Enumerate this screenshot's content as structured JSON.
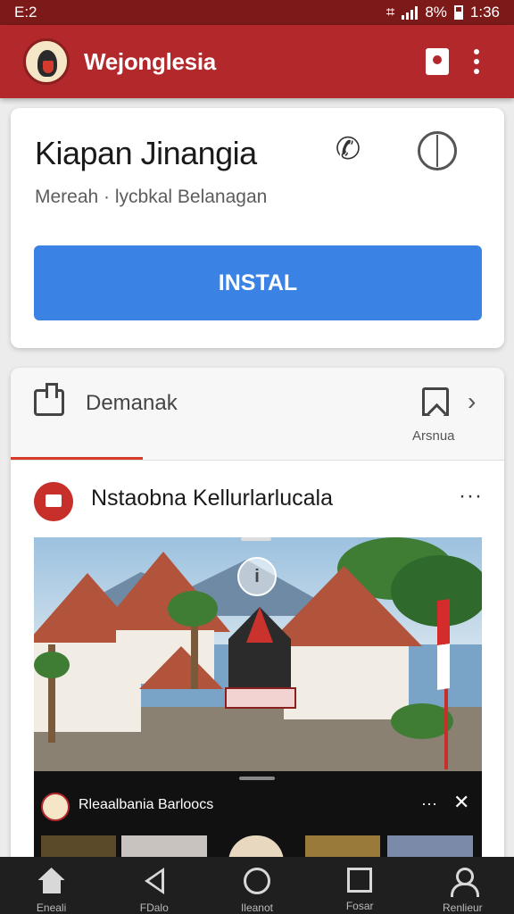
{
  "status_bar": {
    "time_left": "E:2",
    "battery_text": "8%",
    "time_right": "1:36"
  },
  "app_bar": {
    "title": "Wejonglesia",
    "icons": [
      "app-logo-icon",
      "bookmark-icon",
      "more-vert-icon"
    ],
    "accent_color": "#b3282a"
  },
  "listing": {
    "title": "Kiapan Jinangia",
    "subtitle": "Mereah · lycbkal Belanagan",
    "install_label": "INSTAL",
    "install_color": "#3b82e5",
    "icons": [
      "phone-icon",
      "globe-icon"
    ]
  },
  "tabs": {
    "left_label": "Demanak",
    "right_label": "Arsnua",
    "active_indicator_color": "#d63a2a"
  },
  "post": {
    "title": "Nstaobna Kellurlarlucala",
    "more_label": "···"
  },
  "video": {
    "title": "Rleaalbania Barloocs",
    "more_label": "···",
    "close_label": "✕"
  },
  "nav_bar": {
    "items": [
      {
        "label": "Eneali",
        "icon": "home-icon"
      },
      {
        "label": "FDalo",
        "icon": "back-icon"
      },
      {
        "label": "Ileanot",
        "icon": "circle-home-icon"
      },
      {
        "label": "Fosar",
        "icon": "square-recents-icon"
      },
      {
        "label": "Renlieur",
        "icon": "person-icon"
      }
    ]
  }
}
